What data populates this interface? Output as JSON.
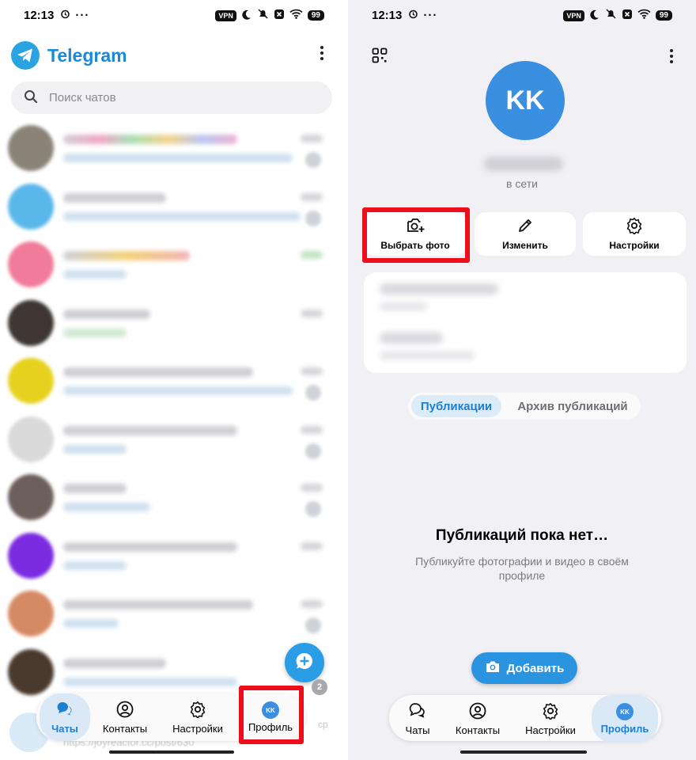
{
  "status_bar": {
    "time": "12:13",
    "dots": "···",
    "vpn": "VPN",
    "battery": "99"
  },
  "chats_screen": {
    "app_title": "Telegram",
    "search_placeholder": "Поиск чатов",
    "unread_badge": "2",
    "nav": {
      "chats": "Чаты",
      "contacts": "Контакты",
      "settings": "Настройки",
      "profile": "Профиль",
      "avatar_initials": "KK"
    },
    "ghost_url": "https://joyreactor.cc/post/630",
    "ghost_side": "ср"
  },
  "profile_screen": {
    "avatar_initials": "KK",
    "status": "в сети",
    "actions": {
      "choose_photo": "Выбрать фото",
      "edit": "Изменить",
      "settings": "Настройки"
    },
    "tabs": {
      "publications": "Публикации",
      "archive": "Архив публикаций"
    },
    "empty_title": "Публикаций пока нет…",
    "empty_subtitle": "Публикуйте фотографии и видео в своём профиле",
    "add_button": "Добавить",
    "nav": {
      "chats": "Чаты",
      "contacts": "Контакты",
      "settings": "Настройки",
      "profile": "Профиль",
      "avatar_initials": "KK"
    }
  },
  "colors": {
    "accent": "#2a94e0",
    "highlight_box": "#ee0d1a"
  }
}
